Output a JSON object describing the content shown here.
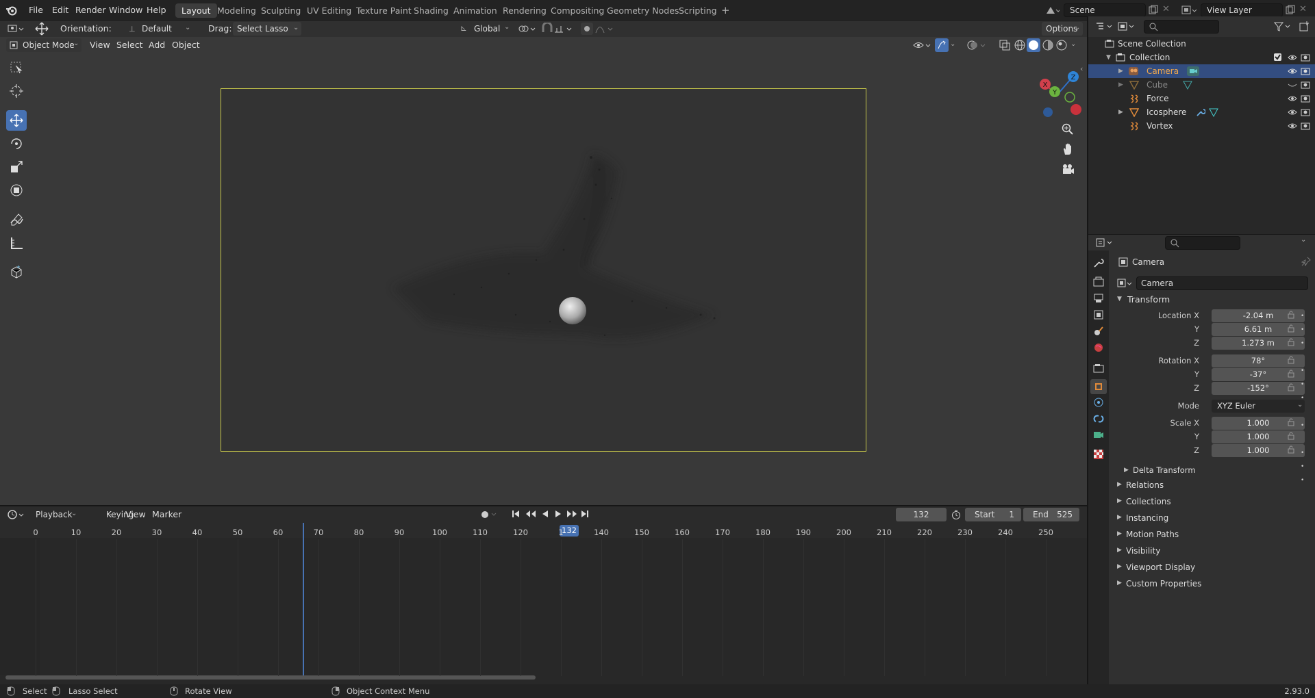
{
  "menu": {
    "file": "File",
    "edit": "Edit",
    "render": "Render",
    "window": "Window",
    "help": "Help"
  },
  "workspaces": [
    "Layout",
    "Modeling",
    "Sculpting",
    "UV Editing",
    "Texture Paint",
    "Shading",
    "Animation",
    "Rendering",
    "Compositing",
    "Geometry Nodes",
    "Scripting"
  ],
  "scene": {
    "name": "Scene",
    "view_layer": "View Layer"
  },
  "tool_header": {
    "orientation_label": "Orientation:",
    "orientation_value": "Default",
    "drag_label": "Drag:",
    "drag_value": "Select Lasso",
    "transform_orientation": "Global",
    "options": "Options"
  },
  "viewport_header": {
    "mode": "Object Mode",
    "view": "View",
    "select": "Select",
    "add": "Add",
    "object": "Object"
  },
  "outliner": {
    "root": "Scene Collection",
    "collection": "Collection",
    "items": [
      {
        "name": "Camera",
        "selected": true
      },
      {
        "name": "Cube",
        "hidden": true
      },
      {
        "name": "Force"
      },
      {
        "name": "Icosphere"
      },
      {
        "name": "Vortex"
      }
    ]
  },
  "properties": {
    "object_name": "Camera",
    "data_name": "Camera",
    "transform_title": "Transform",
    "location": {
      "label_x": "Location X",
      "label_y": "Y",
      "label_z": "Z",
      "x": "-2.04 m",
      "y": "6.61 m",
      "z": "1.273 m"
    },
    "rotation": {
      "label_x": "Rotation X",
      "label_y": "Y",
      "label_z": "Z",
      "x": "78°",
      "y": "-37°",
      "z": "-152°"
    },
    "mode_label": "Mode",
    "mode_value": "XYZ Euler",
    "scale": {
      "label_x": "Scale X",
      "label_y": "Y",
      "label_z": "Z",
      "x": "1.000",
      "y": "1.000",
      "z": "1.000"
    },
    "delta": "Delta Transform",
    "panels": [
      "Relations",
      "Collections",
      "Instancing",
      "Motion Paths",
      "Visibility",
      "Viewport Display",
      "Custom Properties"
    ]
  },
  "timeline": {
    "playback": "Playback",
    "keying": "Keying",
    "view": "View",
    "marker": "Marker",
    "current_frame": "132",
    "start_label": "Start",
    "start": "1",
    "end_label": "End",
    "end": "525",
    "ticks": [
      "0",
      "10",
      "20",
      "30",
      "40",
      "50",
      "60",
      "70",
      "80",
      "90",
      "100",
      "110",
      "120",
      "1",
      "140",
      "150",
      "160",
      "170",
      "180",
      "190",
      "200",
      "210",
      "220",
      "230",
      "240",
      "250"
    ]
  },
  "status": {
    "select": "Select",
    "lasso": "Lasso Select",
    "rotate": "Rotate View",
    "context": "Object Context Menu",
    "version": "2.93.0"
  }
}
